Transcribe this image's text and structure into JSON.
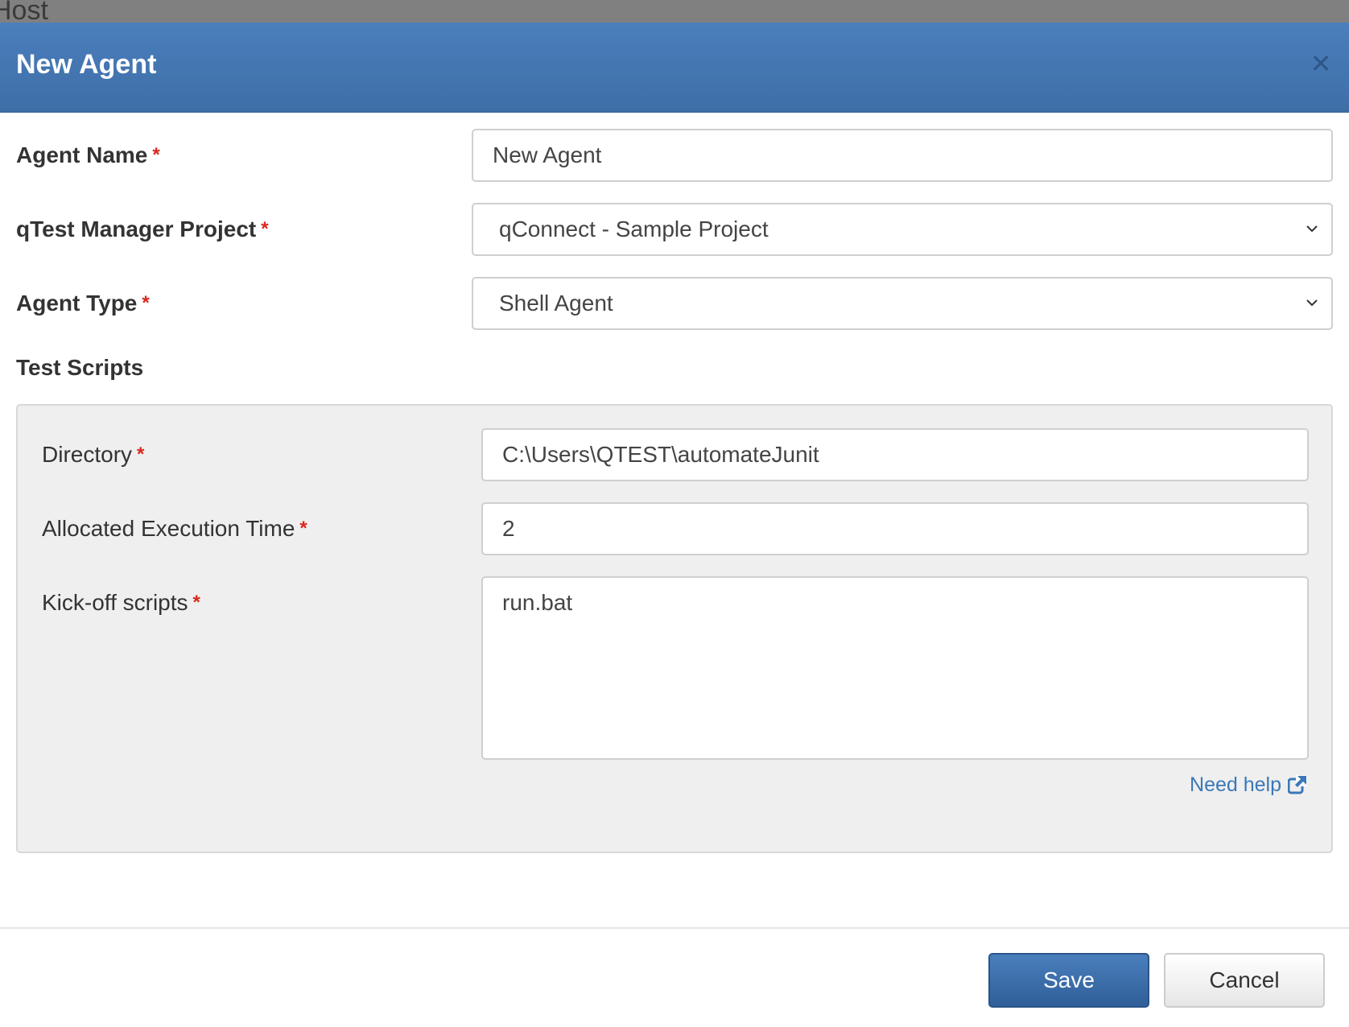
{
  "backdrop": {
    "text": "Host"
  },
  "modal": {
    "title": "New Agent",
    "close_icon": "close-icon"
  },
  "form": {
    "agent_name": {
      "label": "Agent Name",
      "required": "*",
      "value": "New Agent"
    },
    "project": {
      "label": "qTest Manager Project",
      "required": "*",
      "value": "qConnect - Sample Project"
    },
    "agent_type": {
      "label": "Agent Type",
      "required": "*",
      "value": "Shell Agent"
    },
    "test_scripts": {
      "title": "Test Scripts",
      "directory": {
        "label": "Directory",
        "required": "*",
        "value": "C:\\Users\\QTEST\\automateJunit"
      },
      "execution_time": {
        "label": "Allocated Execution Time",
        "required": "*",
        "value": "2"
      },
      "kickoff": {
        "label": "Kick-off scripts",
        "required": "*",
        "value": "run.bat"
      },
      "help": {
        "label": "Need help",
        "icon": "external-link-icon"
      }
    }
  },
  "footer": {
    "save_label": "Save",
    "cancel_label": "Cancel"
  },
  "colors": {
    "header": "#4a7fbd",
    "required": "#d9261c",
    "link": "#3a78b8",
    "panel": "#efefef"
  }
}
